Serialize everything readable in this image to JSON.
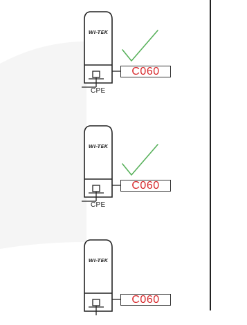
{
  "devices": [
    {
      "brand": "WI-TEK",
      "model_label": "C060",
      "type_label": "CPE",
      "status": "ok",
      "check_icon": "check-mark-icon",
      "check_color": "#58b15b"
    },
    {
      "brand": "WI-TEK",
      "model_label": "C060",
      "type_label": "CPE",
      "status": "ok",
      "check_icon": "check-mark-icon",
      "check_color": "#58b15b"
    },
    {
      "brand": "WI-TEK",
      "model_label": "C060",
      "type_label": "",
      "status": "none"
    }
  ],
  "colors": {
    "label_text": "#d7272a",
    "outline": "#222222",
    "check": "#58b15b"
  }
}
